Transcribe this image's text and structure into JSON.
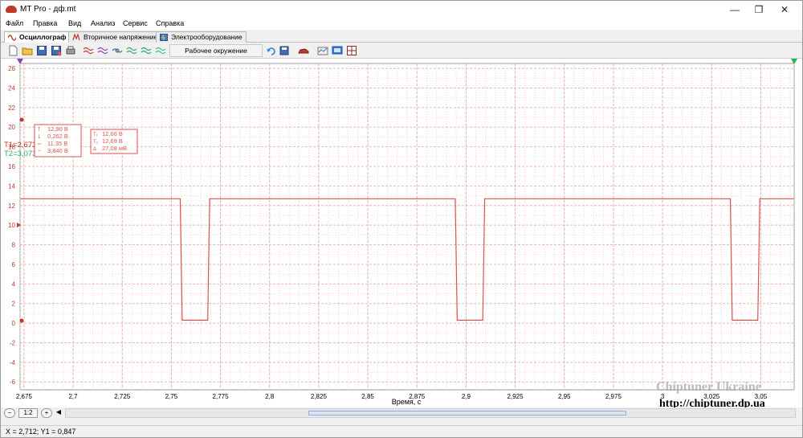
{
  "window": {
    "title": "MT Pro - дф.mt",
    "minimize": "—",
    "restore": "❐",
    "close": "✕"
  },
  "menu": [
    "Файл",
    "Правка",
    "Вид",
    "Анализ",
    "Сервис",
    "Справка"
  ],
  "tabs": [
    {
      "label": "Осциллограф",
      "icon": "sine-wave-icon",
      "active": true
    },
    {
      "label": "Вторичное напряжение",
      "icon": "ignition-icon",
      "active": false
    },
    {
      "label": "Электрооборудование",
      "icon": "electrical-icon",
      "active": false
    }
  ],
  "toolbar": {
    "workspace_label": "Рабочее окружение"
  },
  "chart_data": {
    "type": "line",
    "xlabel": "Время, с",
    "ylabel": "",
    "xlim": [
      2.673,
      3.067
    ],
    "ylim": [
      -6.8,
      26.5
    ],
    "x_ticks": [
      "2,675",
      "2,7",
      "2,725",
      "2,75",
      "2,775",
      "2,8",
      "2,825",
      "2,85",
      "2,875",
      "2,9",
      "2,925",
      "2,95",
      "2,975",
      "3",
      "3,025",
      "3,05"
    ],
    "x_tick_values": [
      2.675,
      2.7,
      2.725,
      2.75,
      2.775,
      2.8,
      2.825,
      2.85,
      2.875,
      2.9,
      2.925,
      2.95,
      2.975,
      3.0,
      3.025,
      3.05
    ],
    "y_ticks": [
      "-6",
      "-4",
      "-2",
      "0",
      "2",
      "4",
      "6",
      "8",
      "10",
      "12",
      "14",
      "16",
      "18",
      "20",
      "22",
      "24",
      "26"
    ],
    "y_tick_values": [
      -6,
      -4,
      -2,
      0,
      2,
      4,
      6,
      8,
      10,
      12,
      14,
      16,
      18,
      20,
      22,
      24,
      26
    ],
    "grid": true,
    "color": "#d9534f",
    "series": [
      {
        "x": [
          2.673,
          2.7545,
          2.7555,
          2.7685,
          2.7695,
          2.8945,
          2.8955,
          2.9085,
          2.9095,
          3.0345,
          3.0355,
          3.0485,
          3.0495,
          3.067
        ],
        "y": [
          12.7,
          12.7,
          0.3,
          0.3,
          12.7,
          12.7,
          0.3,
          0.3,
          12.7,
          12.7,
          0.3,
          0.3,
          12.7,
          12.7
        ]
      }
    ],
    "markers": {
      "t1_label": "T1=2,673",
      "t2_label": "T2=3,073"
    },
    "measurements_left": [
      {
        "icon": "max-arrow-icon",
        "value": "12,90 В"
      },
      {
        "icon": "min-arrow-icon",
        "value": "0,262 В"
      },
      {
        "icon": "average-icon",
        "value": "11,35 В"
      },
      {
        "icon": "peak-to-peak-icon",
        "value": "3,840 В"
      }
    ],
    "measurements_right": [
      {
        "icon": "t1-icon",
        "value": "12,66 В"
      },
      {
        "icon": "t2-icon",
        "value": "12,69 В"
      },
      {
        "icon": "delta-icon",
        "value": "27,08 мВ"
      }
    ]
  },
  "scroll": {
    "zoom_label": "1:2",
    "zoom_out": "−",
    "zoom_in": "+",
    "left": "◀"
  },
  "status": {
    "coordinates": "X = 2,712; Y1 = 0,847"
  },
  "watermark": {
    "line1": "Chiptuner Ukraine",
    "line2": "http://chiptuner.dp.ua"
  }
}
